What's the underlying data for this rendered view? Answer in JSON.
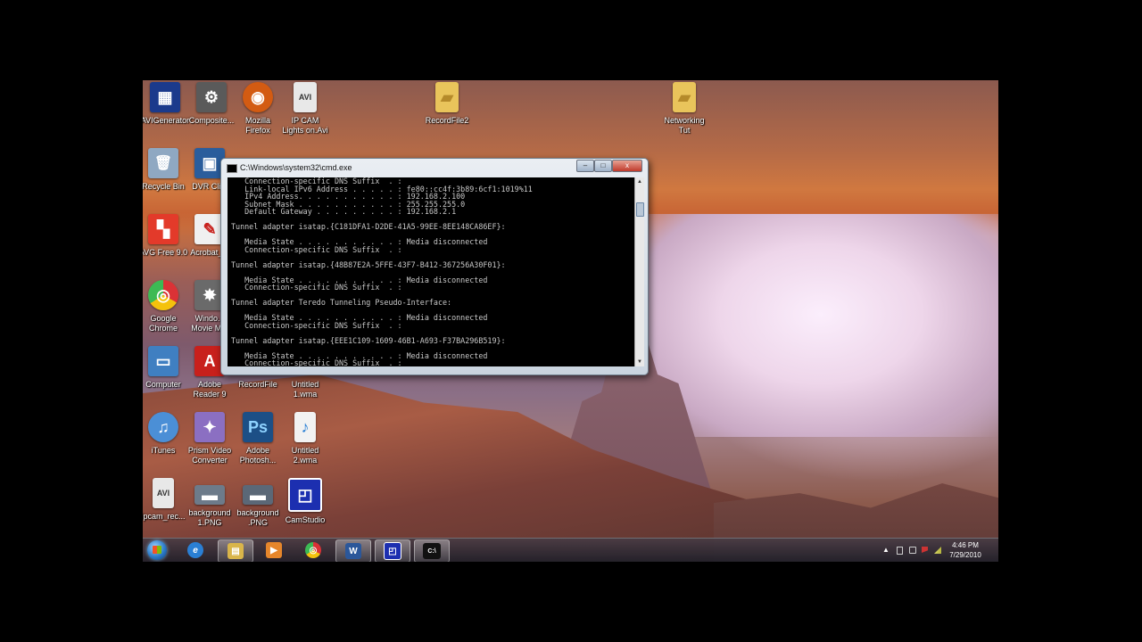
{
  "desktop": {
    "icons": [
      {
        "id": "avigen",
        "label": "AVIGenerator",
        "glyph": "▦",
        "color": "#1b3a8c"
      },
      {
        "id": "composite",
        "label": "Composite...",
        "glyph": "⚙",
        "color": "#5a5a5a"
      },
      {
        "id": "firefox",
        "label": "Mozilla\nFirefox",
        "glyph": "◉",
        "color": "#d35b12"
      },
      {
        "id": "ipcam",
        "label": "IP CAM\nLights on.Avi",
        "glyph": "AVI",
        "color": "#e8e8e8"
      },
      {
        "id": "recordfile2",
        "label": "RecordFile2",
        "glyph": "▰",
        "color": "#e9c45b"
      },
      {
        "id": "networking",
        "label": "Networking\nTut",
        "glyph": "▰",
        "color": "#e9c45b"
      },
      {
        "id": "recycle",
        "label": "Recycle Bin",
        "glyph": "🗑",
        "color": "#8fa8c2"
      },
      {
        "id": "dvr",
        "label": "DVR Cli...",
        "glyph": "▣",
        "color": "#2a5d9c"
      },
      {
        "id": "avg",
        "label": "AVG Free 9.0",
        "glyph": "▚",
        "color": "#e33a2a"
      },
      {
        "id": "acrobat",
        "label": "Acrobat_...",
        "glyph": "✎",
        "color": "#f0f0f0"
      },
      {
        "id": "chrome",
        "label": "Google\nChrome",
        "glyph": "◎",
        "color": "#3aa24a"
      },
      {
        "id": "moviemaker",
        "label": "Windo...\nMovie M...",
        "glyph": "✸",
        "color": "#6a6a6a"
      },
      {
        "id": "computer",
        "label": "Computer",
        "glyph": "▭",
        "color": "#3f7fc1"
      },
      {
        "id": "adobereader",
        "label": "Adobe\nReader 9",
        "glyph": "A",
        "color": "#c8201c"
      },
      {
        "id": "recordfile",
        "label": "RecordFile",
        "glyph": "",
        "color": "rgba(0,0,0,0)"
      },
      {
        "id": "untitled1",
        "label": "Untitled\n1.wma",
        "glyph": "",
        "color": "rgba(0,0,0,0)"
      },
      {
        "id": "itunes",
        "label": "iTunes",
        "glyph": "♫",
        "color": "#4b8fd6"
      },
      {
        "id": "prism",
        "label": "Prism Video\nConverter",
        "glyph": "✦",
        "color": "#8b6fc2"
      },
      {
        "id": "photoshop",
        "label": "Adobe\nPhotosh...",
        "glyph": "Ps",
        "color": "#1c4f86"
      },
      {
        "id": "untitled2",
        "label": "Untitled\n2.wma",
        "glyph": "♪",
        "color": "#f2f2f2"
      },
      {
        "id": "ipcamrec",
        "label": "ipcam_rec...",
        "glyph": "AVI",
        "color": "#e8e8e8"
      },
      {
        "id": "background1",
        "label": "background\n1.PNG",
        "glyph": "▬",
        "color": "#6d7b8a"
      },
      {
        "id": "background",
        "label": "background\n.PNG",
        "glyph": "▬",
        "color": "#5b6877"
      },
      {
        "id": "camstudio",
        "label": "CamStudio",
        "glyph": "◰",
        "color": "#1c2fb0"
      }
    ]
  },
  "cmd_window": {
    "title": "C:\\Windows\\system32\\cmd.exe",
    "controls": {
      "minimize": "–",
      "maximize": "□",
      "close": "x"
    },
    "scroll_up": "▲",
    "scroll_down": "▼",
    "output": "   Connection-specific DNS Suffix  . :\n   Link-local IPv6 Address . . . . . : fe80::cc4f:3b89:6cf1:1019%11\n   IPv4 Address. . . . . . . . . . . : 192.168.2.100\n   Subnet Mask . . . . . . . . . . . : 255.255.255.0\n   Default Gateway . . . . . . . . . : 192.168.2.1\n\nTunnel adapter isatap.{C181DFA1-D2DE-41A5-99EE-8EE148CA86EF}:\n\n   Media State . . . . . . . . . . . : Media disconnected\n   Connection-specific DNS Suffix  . :\n\nTunnel adapter isatap.{48B87E2A-5FFE-43F7-B412-367256A30F01}:\n\n   Media State . . . . . . . . . . . : Media disconnected\n   Connection-specific DNS Suffix  . :\n\nTunnel adapter Teredo Tunneling Pseudo-Interface:\n\n   Media State . . . . . . . . . . . : Media disconnected\n   Connection-specific DNS Suffix  . :\n\nTunnel adapter isatap.{EEE1C109-1609-46B1-A693-F37BA296B519}:\n\n   Media State . . . . . . . . . . . : Media disconnected\n   Connection-specific DNS Suffix  . :"
  },
  "taskbar": {
    "start_label": "Start",
    "buttons": [
      {
        "id": "ie",
        "glyph": "e",
        "color": "#2a7fd4"
      },
      {
        "id": "explorer",
        "glyph": "▤",
        "color": "#d9b54a"
      },
      {
        "id": "mediaplayer",
        "glyph": "▶",
        "color": "#e6862b"
      },
      {
        "id": "chrome",
        "glyph": "◎",
        "color": "#3aa24a"
      },
      {
        "id": "word",
        "glyph": "W",
        "color": "#2b579a"
      },
      {
        "id": "camstudio",
        "glyph": "◰",
        "color": "#1c2fb0"
      },
      {
        "id": "cmd",
        "glyph": "C:\\",
        "color": "#111111"
      }
    ],
    "tray": {
      "show_hidden": "▲",
      "time": "4:46 PM",
      "date": "7/29/2010"
    }
  }
}
